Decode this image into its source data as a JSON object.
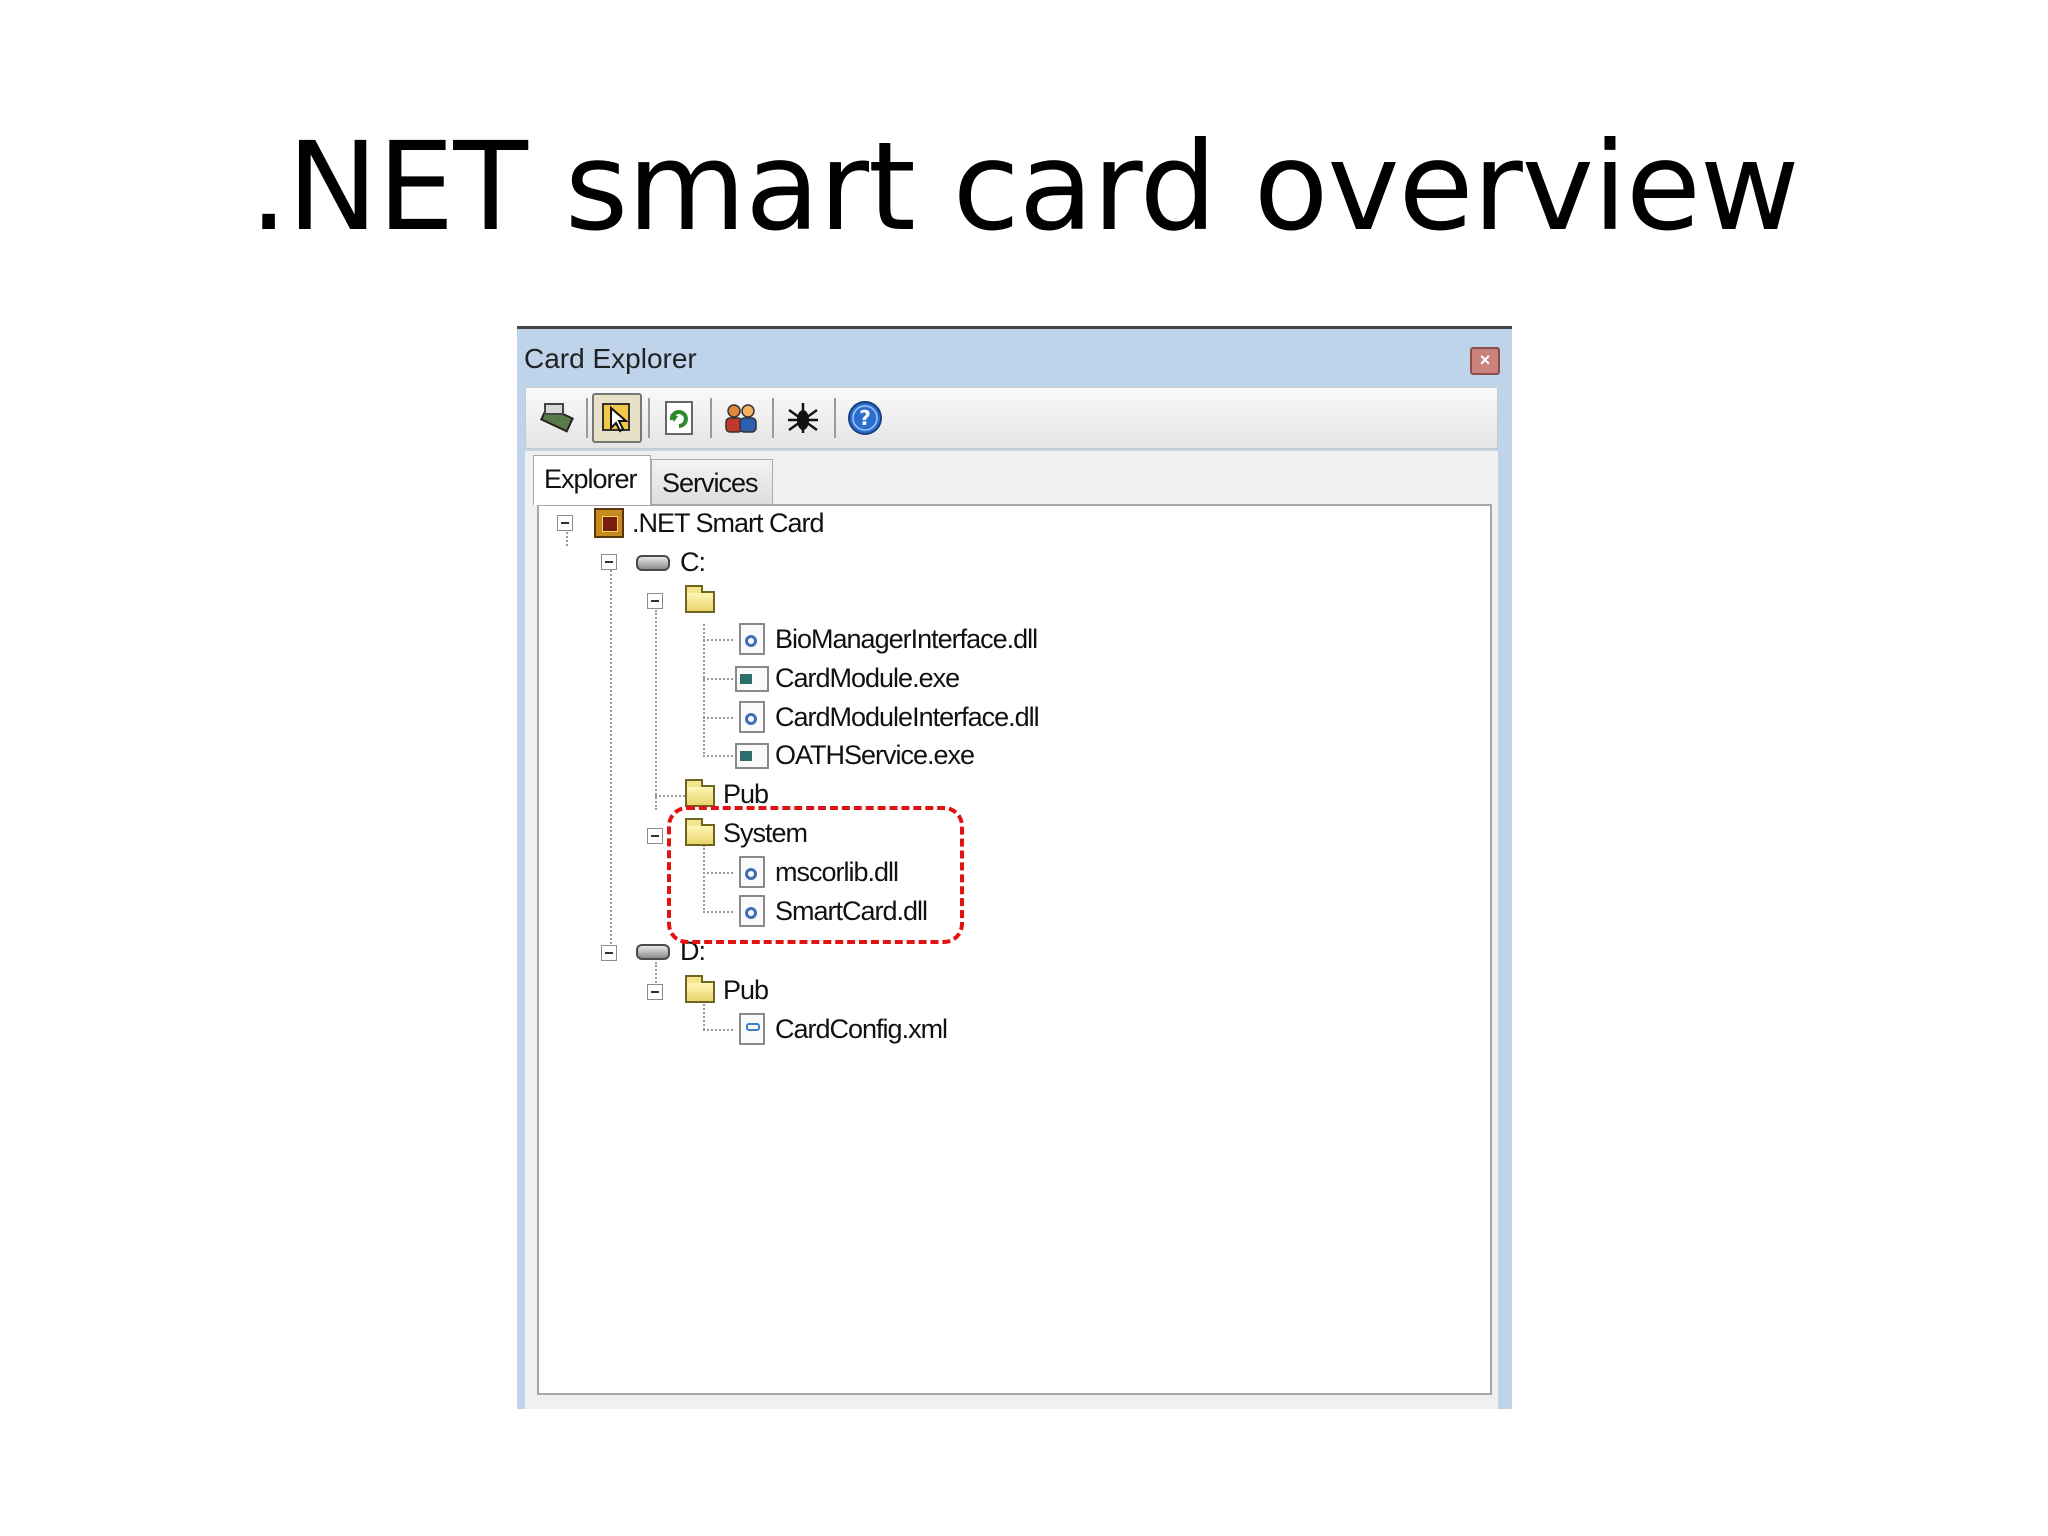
{
  "slide": {
    "title": ".NET smart card overview"
  },
  "window": {
    "title": "Card Explorer",
    "close_icon": "close-icon",
    "toolbar": [
      {
        "name": "card-reader-icon"
      },
      {
        "name": "select-tool-icon",
        "active": true
      },
      {
        "name": "refresh-icon"
      },
      {
        "name": "users-icon"
      },
      {
        "name": "debug-bug-icon"
      },
      {
        "name": "help-icon"
      }
    ],
    "tabs": [
      {
        "label": "Explorer",
        "selected": true
      },
      {
        "label": "Services",
        "selected": false
      }
    ]
  },
  "tree": {
    "root": ".NET Smart Card",
    "drive_c": "C:",
    "root_folder_files": [
      "BioManagerInterface.dll",
      "CardModule.exe",
      "CardModuleInterface.dll",
      "OATHService.exe"
    ],
    "pub_c": "Pub",
    "system": "System",
    "system_files": [
      "mscorlib.dll",
      "SmartCard.dll"
    ],
    "drive_d": "D:",
    "pub_d": "Pub",
    "pub_d_files": [
      "CardConfig.xml"
    ]
  }
}
